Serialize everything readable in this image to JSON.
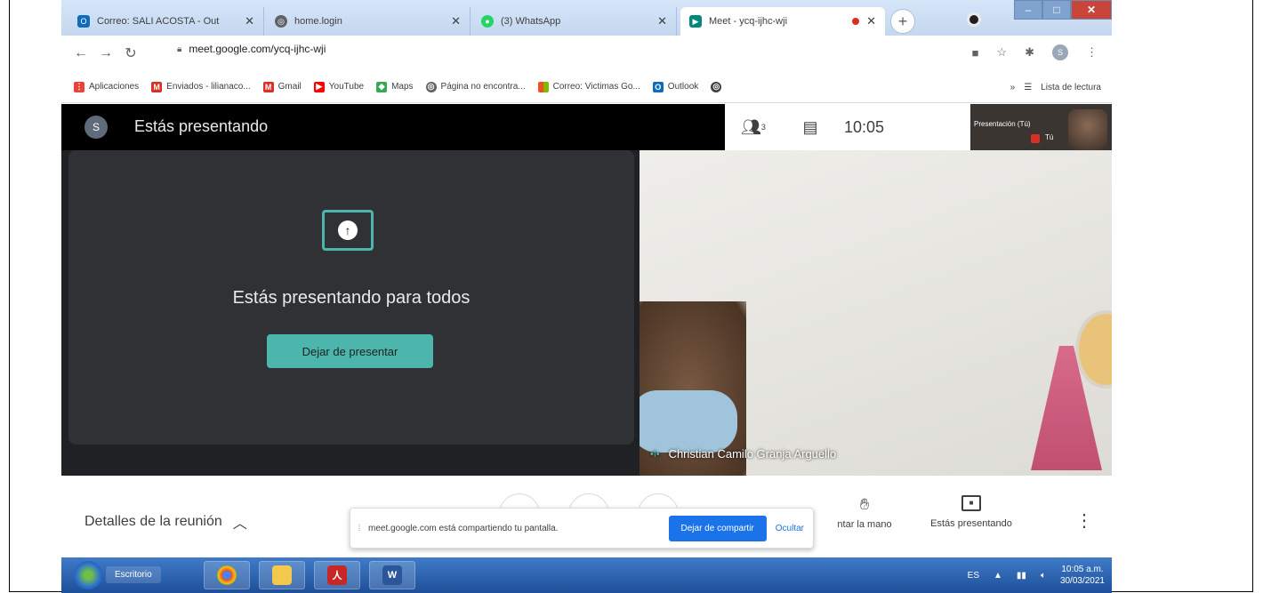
{
  "tabs": [
    {
      "title": "Correo: SALI ACOSTA - Out",
      "icon": "outlook-icon",
      "color": "#0f6cbd"
    },
    {
      "title": "home.login",
      "icon": "globe-icon",
      "color": "#5f6368"
    },
    {
      "title": "(3) WhatsApp",
      "icon": "whatsapp-icon",
      "color": "#25d366"
    },
    {
      "title": "Meet - ycq-ijhc-wji",
      "icon": "meet-icon",
      "color": "#00897b"
    }
  ],
  "address_bar": {
    "url": "meet.google.com/ycq-ijhc-wji"
  },
  "bookmarks": [
    {
      "label": "Aplicaciones",
      "icon": "apps-grid-icon",
      "color": "#ea4335"
    },
    {
      "label": "Enviados - lilianaco...",
      "icon": "gmail-icon",
      "color": "#d93025"
    },
    {
      "label": "Gmail",
      "icon": "gmail-icon",
      "color": "#d93025"
    },
    {
      "label": "YouTube",
      "icon": "youtube-icon",
      "color": "#ff0000"
    },
    {
      "label": "Maps",
      "icon": "maps-icon",
      "color": "#34a853"
    },
    {
      "label": "Página no encontra...",
      "icon": "globe-icon",
      "color": "#5f6368"
    },
    {
      "label": "Correo: Victimas Go...",
      "icon": "microsoft-icon",
      "color": "#f25022"
    },
    {
      "label": "Outlook",
      "icon": "outlook-icon",
      "color": "#0f6cbd"
    }
  ],
  "reading_list": "Lista de lectura",
  "meet": {
    "avatar_letter": "S",
    "header_title": "Estás presentando",
    "participants_count": "3",
    "clock": "10:05",
    "thumb_label": "Presentación (Tú)",
    "thumb_you": "Tú",
    "present_message": "Estás presentando para todos",
    "stop_presenting": "Dejar de presentar",
    "participant_name": "Christian Camilo Granja Arguello"
  },
  "bottom": {
    "details": "Detalles de la reunión",
    "share_text": "meet.google.com está compartiendo tu pantalla.",
    "stop_sharing": "Dejar de compartir",
    "hide": "Ocultar",
    "raise_hand": "ntar la mano",
    "presenting": "Estás presentando"
  },
  "taskbar": {
    "desktop_label": "Escritorio",
    "lang": "ES",
    "time": "10:05 a.m.",
    "date": "30/03/2021"
  }
}
